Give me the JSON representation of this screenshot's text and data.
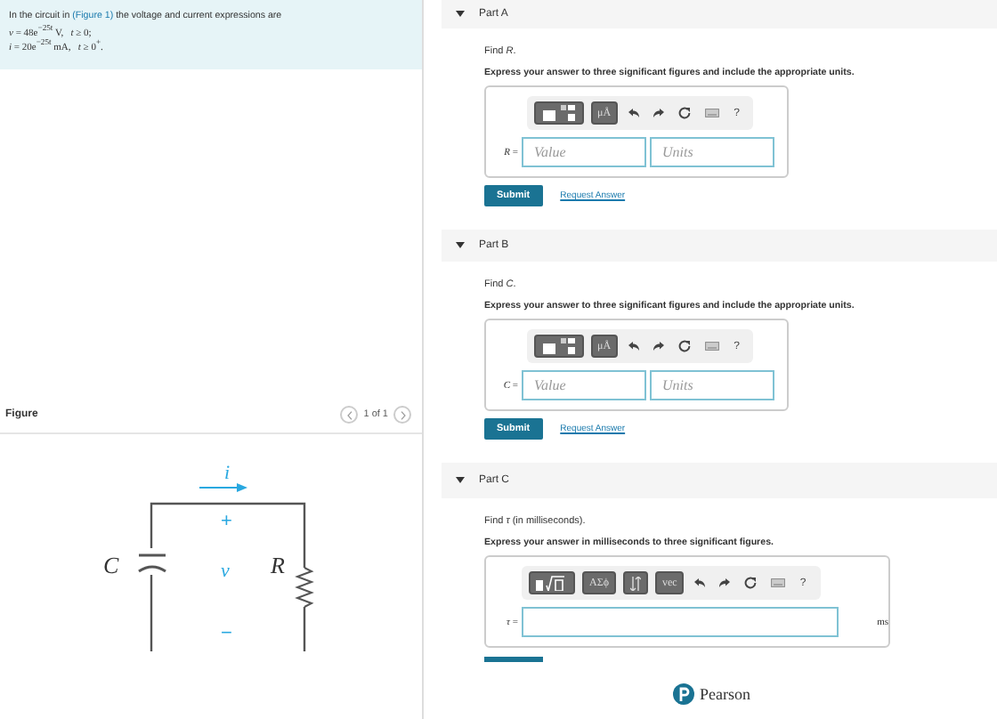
{
  "problem": {
    "text_before": "In the circuit in ",
    "link": "(Figure 1)",
    "text_after": " the voltage and current expressions are",
    "equations": [
      "*v* = 48e$^{−25t}$ V,   *t* ≥ 0;",
      "*i* = 20e$^{−25t}$ mA,   *t* ≥ 0$^{+}$."
    ]
  },
  "figure": {
    "title": "Figure",
    "pager": "1 of 1",
    "labels": {
      "current": "i",
      "plus": "+",
      "voltage": "v",
      "minus": "−",
      "capacitor": "C",
      "resistor": "R"
    }
  },
  "parts": [
    {
      "title": "Part A",
      "expanded": true,
      "prompt": "Find *R*.",
      "instruction": "Express your answer to three significant figures and include the appropriate units.",
      "kind": "value_units",
      "variable": "*R* =",
      "value_placeholder": "Value",
      "units_placeholder": "Units",
      "submit": "Submit",
      "request": "Request Answer",
      "symbols": [
        "μÅ"
      ],
      "help": "?"
    },
    {
      "title": "Part B",
      "expanded": true,
      "prompt": "Find *C*.",
      "instruction": "Express your answer to three significant figures and include the appropriate units.",
      "kind": "value_units",
      "variable": "*C* =",
      "value_placeholder": "Value",
      "units_placeholder": "Units",
      "submit": "Submit",
      "request": "Request Answer",
      "symbols": [
        "μÅ"
      ],
      "help": "?"
    },
    {
      "title": "Part C",
      "expanded": true,
      "prompt": "Find *τ* (in milliseconds).",
      "instruction": "Express your answer in milliseconds to three significant figures.",
      "kind": "single",
      "variable": "*τ* =",
      "unit": "ms",
      "symbols": [
        "ΑΣϕ",
        "vec"
      ],
      "help": "?"
    }
  ],
  "footer": {
    "brand": "Pearson"
  }
}
